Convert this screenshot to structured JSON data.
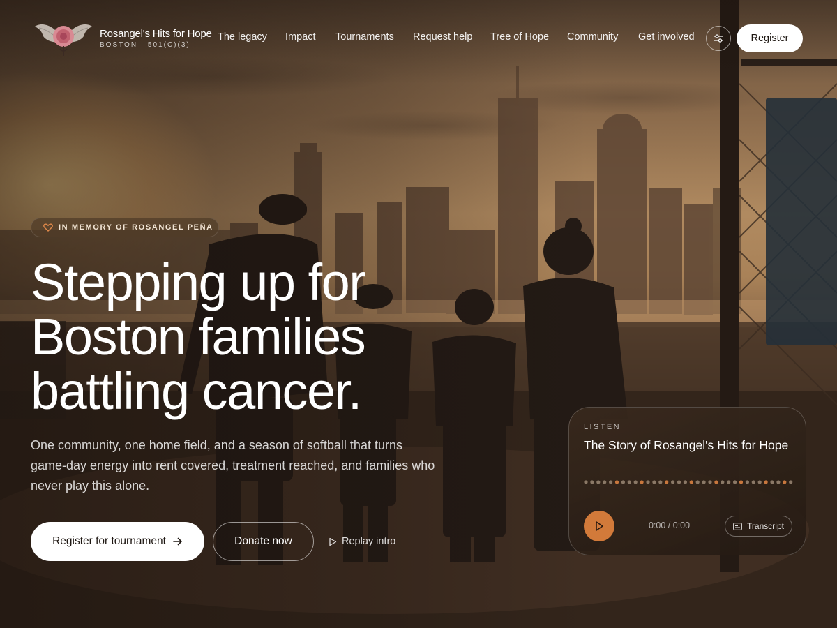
{
  "brand": {
    "name": "Rosangel's Hits for Hope",
    "subtitle": "BOSTON · 501(C)(3)"
  },
  "nav": {
    "items": [
      {
        "label": "The legacy"
      },
      {
        "label": "Impact"
      },
      {
        "label": "Tournaments"
      },
      {
        "label": "Request help"
      },
      {
        "label": "Tree of Hope"
      },
      {
        "label": "Community"
      },
      {
        "label": "Get involved"
      }
    ],
    "settings_icon": "sliders-icon",
    "register_label": "Register"
  },
  "hero": {
    "memory_badge": "IN MEMORY OF ROSANGEL PEÑA",
    "headline_lines": [
      "Stepping up for",
      "Boston families",
      "battling cancer."
    ],
    "lede": "One community, one home field, and a season of softball that turns game-day energy into rent covered, treatment reached, and families who never play this alone.",
    "cta_primary": "Register for tournament",
    "cta_secondary": "Donate now",
    "replay_label": "Replay intro"
  },
  "listen": {
    "label": "LISTEN",
    "title": "The Story of Rosangel's Hits for Hope",
    "time": "0:00 / 0:00",
    "transcript_label": "Transcript",
    "progress": 0
  },
  "colors": {
    "accent": "#d27a3a",
    "waveform_dot": "#8a7866",
    "waveform_dot_accent": "#c8773d"
  }
}
